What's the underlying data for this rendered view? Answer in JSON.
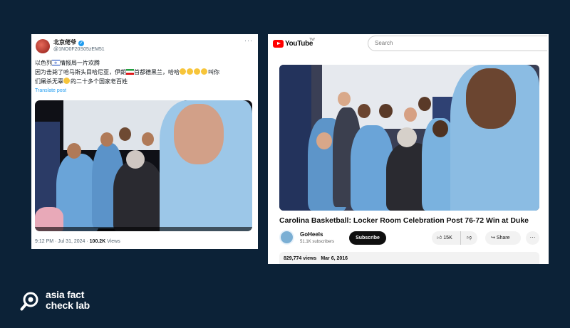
{
  "tweet": {
    "display_name": "北京佬爷",
    "handle": "@1NO0F20S05zEM51",
    "text_line1_a": "以色列",
    "text_line1_b": "情报局一片欢腾",
    "text_line2_a": "因为击毙了哈马斯头目哈尼亚，伊朗",
    "text_line2_b": "首都德黑兰，哈哈",
    "text_line2_c": "叫你",
    "text_line3_b": "的二十多个国家老百姓",
    "text_line3_a": "们屠杀无辜",
    "translate_label": "Translate post",
    "time": "9:12 PM · Jul 31, 2024 · ",
    "views_count": "100.2K",
    "views_label": " Views"
  },
  "youtube": {
    "logo_text": "YouTube",
    "logo_tm": "TW",
    "search_placeholder": "Search",
    "video_title": "Carolina Basketball: Locker Room Celebration Post 76-72 Win at Duke",
    "channel_name": "GoHeels",
    "subscribers": "51.1K subscribers",
    "subscribe_label": "Subscribe",
    "likes": "15K",
    "share_label": "Share",
    "views": "829,774 views",
    "date": "Mar 6, 2016"
  },
  "watermark": {
    "line1": "asia fact",
    "line2": "check lab"
  },
  "colors": {
    "background": "#0c2237",
    "twitter_blue": "#1d9bf0",
    "youtube_red": "#ff0000"
  }
}
